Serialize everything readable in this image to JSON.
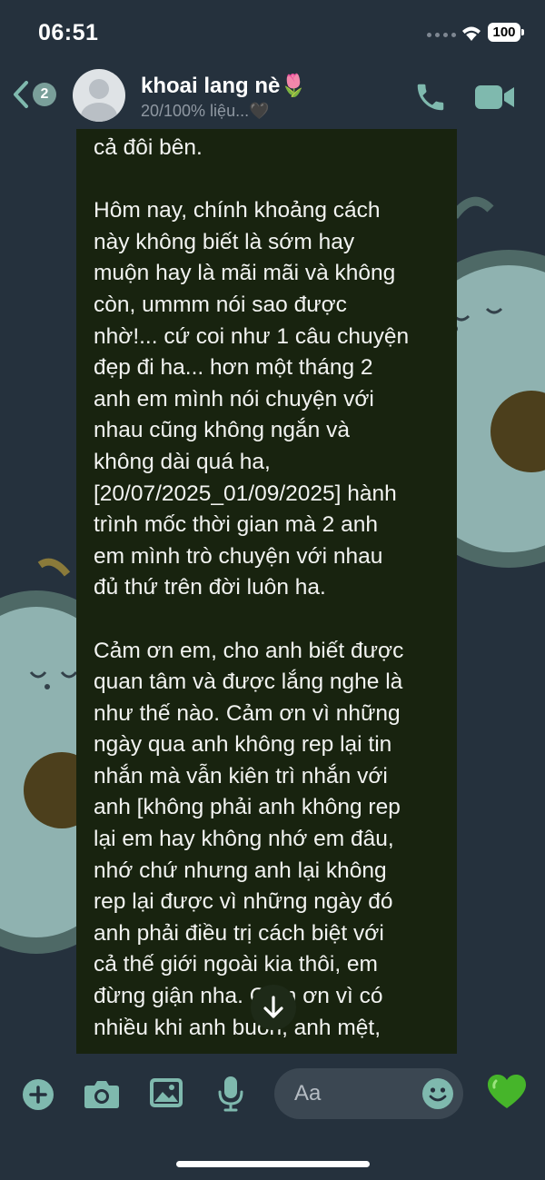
{
  "status_bar": {
    "time": "06:51",
    "battery": "100"
  },
  "header": {
    "unread_count": "2",
    "contact_name": "khoai lang nè🌷",
    "contact_status": "20/100% liệu...🖤"
  },
  "message": {
    "text": "cả đôi bên.\n\nHôm nay, chính khoảng cách\nnày không biết là sớm hay\nmuộn hay là mãi mãi và không\ncòn, ummm nói sao được\nnhờ!... cứ coi như 1 câu chuyện\nđẹp đi ha... hơn một tháng 2\nanh em mình nói chuyện với\nnhau cũng không ngắn và\nkhông dài quá ha,\n[20/07/2025_01/09/2025] hành\ntrình mốc thời gian mà 2 anh\nem mình trò chuyện với nhau\nđủ thứ trên đời luôn ha.\n\nCảm ơn em, cho anh biết được\nquan tâm và được lắng nghe là\nnhư thế nào. Cảm ơn vì những\nngày qua anh không rep lại tin\nnhắn mà vẫn kiên trì nhắn với\nanh [không phải anh không rep\nlại em hay không nhớ em đâu,\nnhớ chứ nhưng anh lại không\nrep lại được vì những ngày đó\nanh phải điều trị cách biệt với\ncả thế giới ngoài kia thôi, em\nđừng giận nha. Cảm ơn vì có\nnhiều khi anh buồn, anh mệt,"
  },
  "composer": {
    "placeholder": "Aa"
  },
  "icons": {
    "back": "chevron-left-icon",
    "call": "phone-icon",
    "video": "video-camera-icon",
    "plus": "plus-icon",
    "camera": "camera-icon",
    "gallery": "image-icon",
    "mic": "microphone-icon",
    "emoji": "emoji-icon",
    "like": "green-heart-icon",
    "scroll_down": "arrow-down-icon"
  },
  "colors": {
    "background": "#25313d",
    "accent": "#7fb9ae",
    "bubble": "#18230f",
    "wallpaper_avocado": "#5f7a74"
  }
}
